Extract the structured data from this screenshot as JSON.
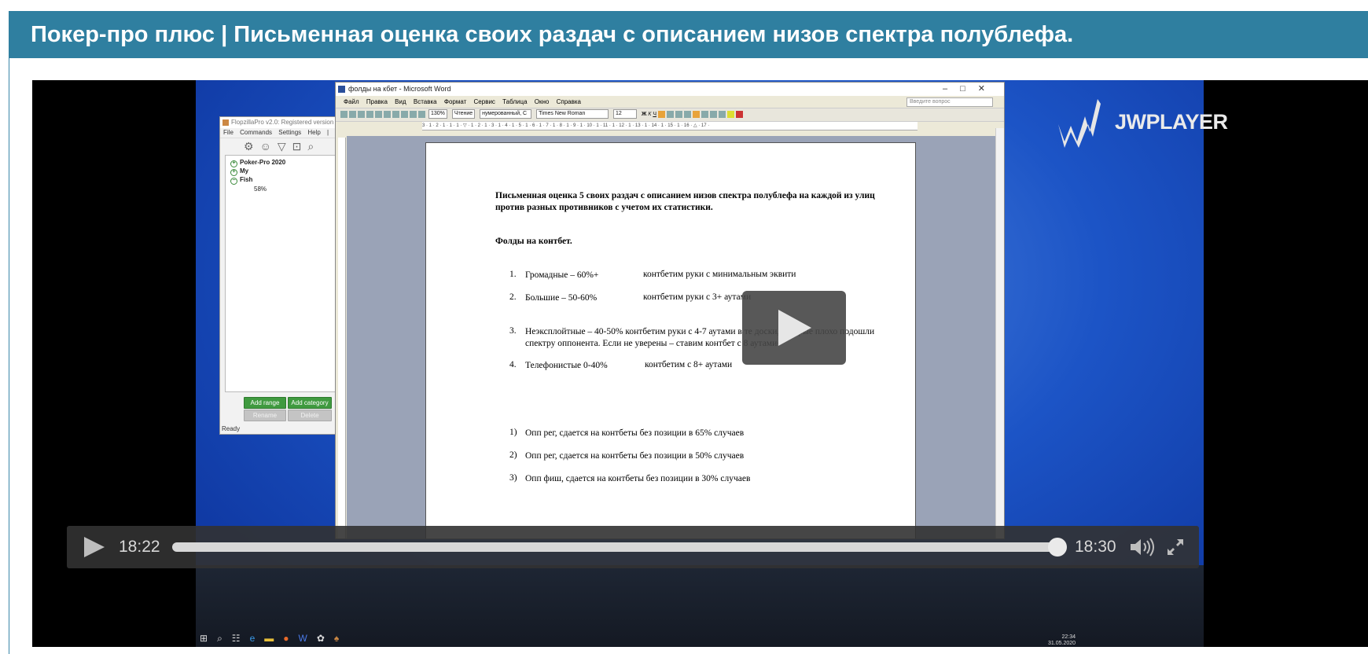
{
  "page": {
    "title": "Покер-про плюс | Письменная оценка своих раздач с описанием низов спектра полублефа."
  },
  "flopzilla": {
    "title": "FlopzillaPro v2.0: Registered version",
    "menu": "File  Commands  Settings  Help  |  GTO",
    "tree": [
      {
        "label": "Poker-Pro 2020",
        "sign": "+"
      },
      {
        "label": "My",
        "sign": "+"
      },
      {
        "label": "Fish",
        "sign": "−"
      }
    ],
    "sub_value": "58%",
    "buttons": {
      "add_range": "Add range",
      "add_category": "Add category",
      "rename": "Rename",
      "delete": "Delete"
    },
    "status": "Ready"
  },
  "word": {
    "title": "фолды на кбет - Microsoft Word",
    "menu": [
      "Файл",
      "Правка",
      "Вид",
      "Вставка",
      "Формат",
      "Сервис",
      "Таблица",
      "Окно",
      "Справка"
    ],
    "ask_placeholder": "Введите вопрос",
    "zoom": "130%",
    "reading_btn": "Чтение",
    "style": "нумерованный, С",
    "font": "Times New Roman",
    "font_size": "12",
    "ruler": "3 · 1 · 2 · 1 · 1 · 1 · ▽ · 1 · 2 · 1 · 3 · 1 · 4 · 1 · 5 · 1 · 6 · 1 · 7 · 1 · 8 · 1 · 9 · 1 · 10 · 1 · 11 · 1 · 12 · 1 · 13 · 1 · 14 · 1 · 15 · 1 · 16 · △ · 17 ·",
    "doc": {
      "heading": "Письменная оценка 5 своих раздач с описанием низов спектра полублефа на каждой из улиц против разных противников с учетом их статистики.",
      "subheading": "Фолды на контбет.",
      "list": [
        {
          "num": "1.",
          "text": "Громадные – 60%+",
          "desc": "контбетим руки с минимальным эквити"
        },
        {
          "num": "2.",
          "text": "Большие – 50-60%",
          "desc": "контбетим руки с 3+ аутами"
        },
        {
          "num": "3.",
          "text": "Неэксплойтные – 40-50% контбетим руки с 4-7 аутами в те доски, которые плохо подошли спектру оппонента. Если не уверены – ставим контбет с 8 аутами+",
          "desc": ""
        },
        {
          "num": "4.",
          "text": "Телефонистые 0-40%",
          "desc": "контбетим с 8+ аутами"
        }
      ],
      "list2": [
        {
          "num": "1)",
          "text": "Опп рег, сдается на контбеты без позиции в 65% случаев"
        },
        {
          "num": "2)",
          "text": "Опп рег, сдается на контбеты без позиции в 50% случаев"
        },
        {
          "num": "3)",
          "text": "Опп фиш, сдается на контбеты без позиции в 30% случаев"
        }
      ]
    }
  },
  "player": {
    "brand": "JWPLAYER",
    "current_time": "18:22",
    "duration": "18:30",
    "progress": 0.99
  },
  "taskbar": {
    "time": "22:34",
    "date": "31.05.2020"
  }
}
